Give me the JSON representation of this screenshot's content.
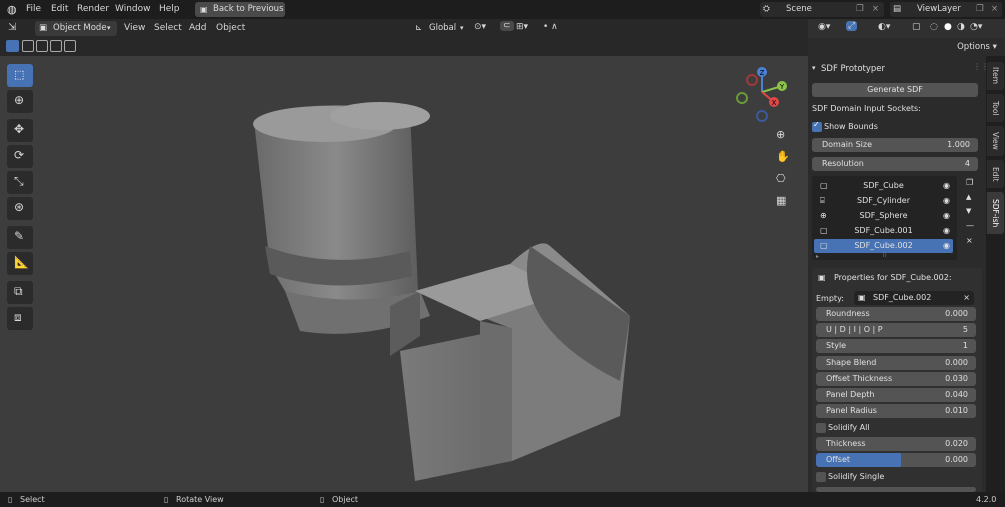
{
  "menubar": {
    "items": [
      "File",
      "Edit",
      "Render",
      "Window",
      "Help"
    ],
    "back_button": "Back to Previous",
    "scene": "Scene",
    "view_layer": "ViewLayer"
  },
  "header": {
    "mode": "Object Mode",
    "menus": [
      "View",
      "Select",
      "Add",
      "Object"
    ],
    "transform": "Global",
    "options": "Options"
  },
  "panel": {
    "title": "SDF Prototyper",
    "generate": "Generate SDF",
    "sockets_label": "SDF Domain Input Sockets:",
    "show_bounds": "Show Bounds",
    "show_bounds_checked": true,
    "domain_size": {
      "label": "Domain Size",
      "value": "1.000"
    },
    "resolution": {
      "label": "Resolution",
      "value": "4"
    },
    "items": [
      {
        "name": "SDF_Cube",
        "icon": "cube-icon"
      },
      {
        "name": "SDF_Cylinder",
        "icon": "cylinder-icon"
      },
      {
        "name": "SDF_Sphere",
        "icon": "sphere-icon"
      },
      {
        "name": "SDF_Cube.001",
        "icon": "cube-icon"
      },
      {
        "name": "SDF_Cube.002",
        "icon": "cube-icon"
      }
    ],
    "selected_index": 4,
    "properties_title": "Properties for SDF_Cube.002:",
    "empty_label": "Empty:",
    "empty_value": "SDF_Cube.002",
    "props": [
      {
        "label": "Roundness",
        "value": "0.000"
      },
      {
        "label": "U | D | I | O | P",
        "value": "5"
      },
      {
        "label": "Style",
        "value": "1"
      },
      {
        "label": "Shape Blend",
        "value": "0.000"
      },
      {
        "label": "Offset Thickness",
        "value": "0.030"
      },
      {
        "label": "Panel Depth",
        "value": "0.040"
      },
      {
        "label": "Panel Radius",
        "value": "0.010"
      }
    ],
    "solidify_all": "Solidify All",
    "thickness": {
      "label": "Thickness",
      "value": "0.020"
    },
    "offset": {
      "label": "Offset",
      "value": "0.000",
      "fill": 0.53
    },
    "solidify_single": "Solidify Single"
  },
  "tabs": [
    "Item",
    "Tool",
    "View",
    "Edit",
    "SDF-ish"
  ],
  "active_tab": "SDF-ish",
  "gizmo": {
    "z": "Z",
    "y": "Y",
    "x": "X"
  },
  "status": {
    "select": "Select",
    "rotate": "Rotate View",
    "object": "Object",
    "version": "4.2.0"
  }
}
